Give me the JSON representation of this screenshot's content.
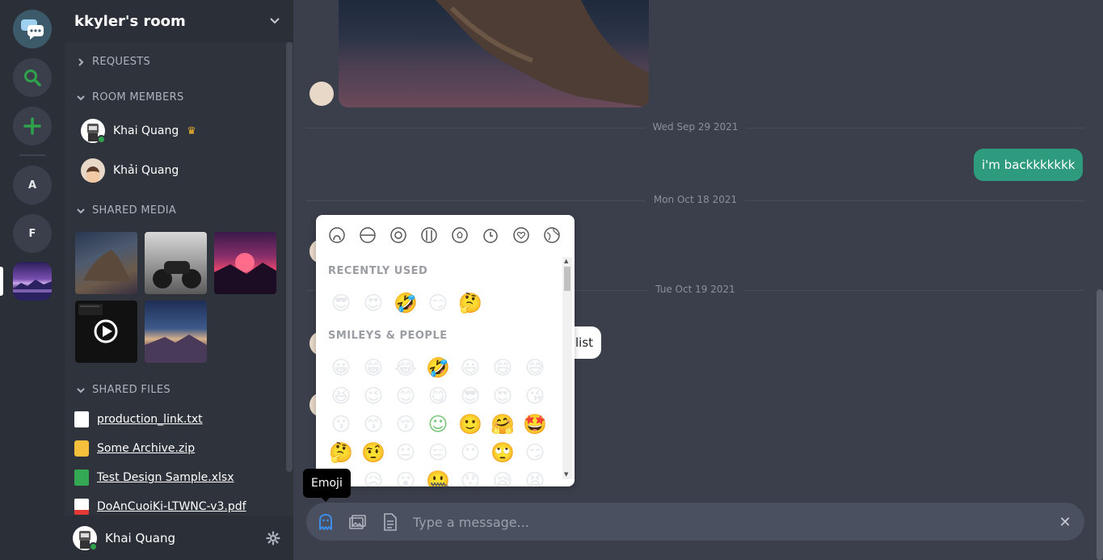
{
  "rail": {
    "items": [
      {
        "name": "chat-logo",
        "label": ""
      },
      {
        "name": "search",
        "label": ""
      },
      {
        "name": "add",
        "label": ""
      },
      {
        "name": "room-a",
        "label": "A"
      },
      {
        "name": "room-f",
        "label": "F"
      }
    ],
    "accent_green": "#31a24c"
  },
  "sidebar": {
    "room_title": "kkyler's room",
    "sections": {
      "requests": "REQUESTS",
      "room_members": "ROOM MEMBERS",
      "shared_media": "SHARED MEDIA",
      "shared_files": "SHARED FILES"
    },
    "members": [
      {
        "name": "Khai Quang",
        "owner": true,
        "online": true
      },
      {
        "name": "Khải Quang",
        "owner": false,
        "online": false
      }
    ],
    "files": [
      {
        "name": "production_link.txt",
        "icon": "text-file-icon"
      },
      {
        "name": "Some Archive.zip",
        "icon": "folder-icon"
      },
      {
        "name": "Test Design Sample.xlsx",
        "icon": "spreadsheet-icon"
      },
      {
        "name": "DoAnCuoiKi-LTWNC-v3.pdf",
        "icon": "pdf-icon"
      }
    ],
    "current_user": "Khai Quang"
  },
  "chat": {
    "dates": [
      "Wed Sep 29 2021",
      "Mon Oct 18 2021",
      "Tue Oct 19 2021"
    ],
    "my_message": "i'm backkkkkkk",
    "other_message_tail": "list",
    "tooltip": "Emoji",
    "composer_placeholder": "Type a message...",
    "bubble_color": "#2e9a7e"
  },
  "emoji_picker": {
    "categories": [
      "people",
      "food",
      "activities",
      "travel",
      "sports",
      "time",
      "symbols",
      "flags"
    ],
    "recently_used_title": "RECENTLY USED",
    "recently_used": [
      "😎",
      "😍",
      "🤣",
      "😏",
      "🤔"
    ],
    "smileys_title": "SMILEYS & PEOPLE",
    "smileys": [
      [
        "😀",
        "😁",
        "😂",
        "🤣",
        "😃",
        "😄",
        "😅"
      ],
      [
        "😆",
        "😉",
        "😊",
        "😋",
        "😎",
        "😍",
        "😘"
      ],
      [
        "😗",
        "😙",
        "😚",
        "☺",
        "🙂",
        "🤗",
        "🤩"
      ],
      [
        "🤔",
        "🤨",
        "😐",
        "😑",
        "😶",
        "🙄",
        "😏"
      ],
      [
        "😣",
        "😥",
        "😮",
        "🤐",
        "😯",
        "😪",
        "😫"
      ]
    ]
  }
}
